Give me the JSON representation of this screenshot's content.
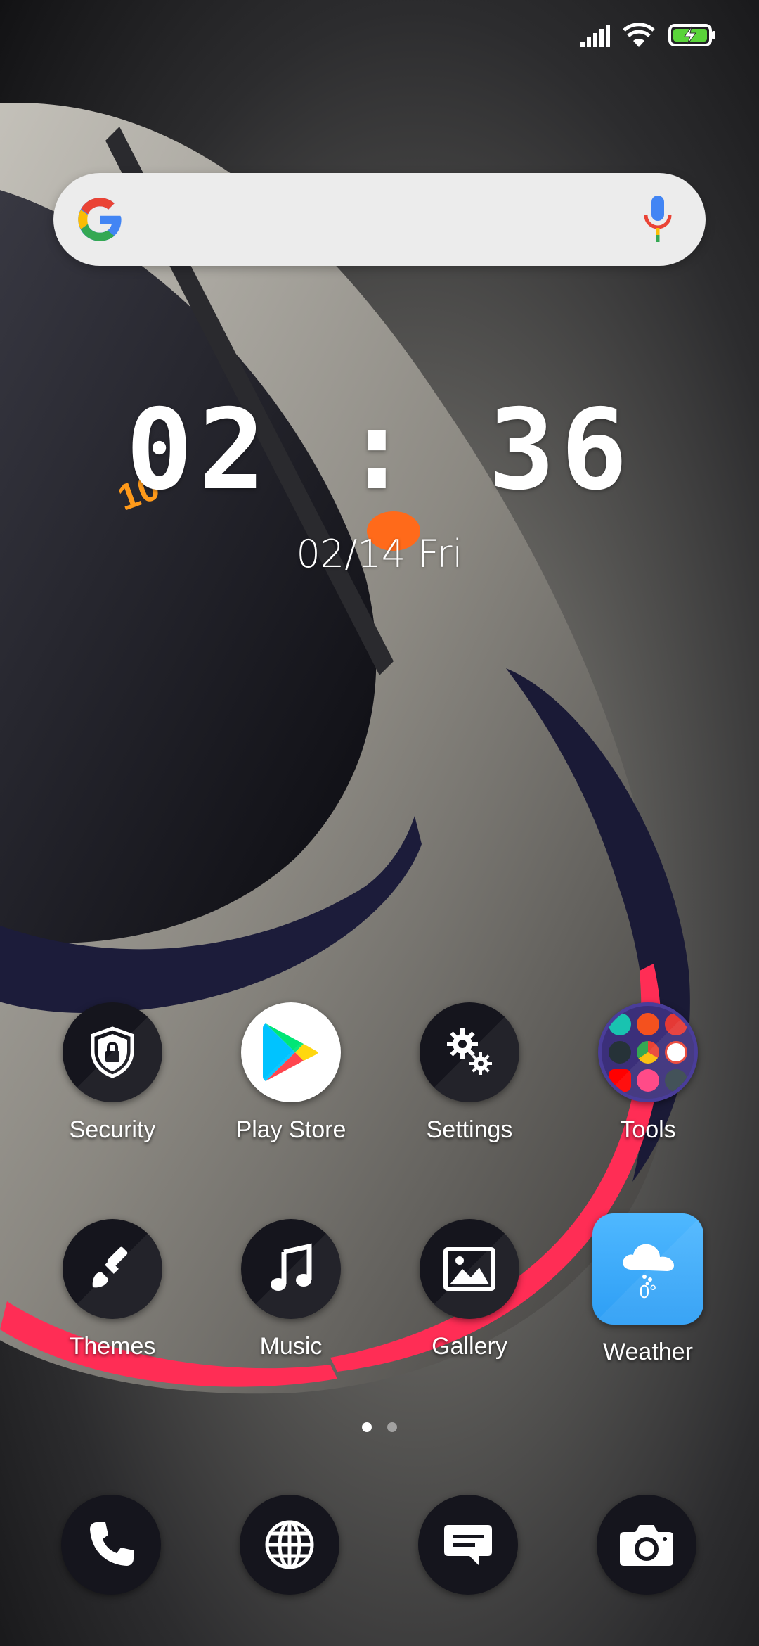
{
  "status_bar": {
    "icons": [
      "signal-icon",
      "wifi-icon",
      "battery-charging-icon"
    ],
    "battery_color": "#5ad43a"
  },
  "search_widget": {
    "logo": "google-logo",
    "mic_icon": "mic-icon"
  },
  "clock": {
    "time": "02 : 36",
    "date": "02/14 Fri"
  },
  "apps": [
    {
      "label": "Security",
      "icon": "shield-lock-icon"
    },
    {
      "label": "Play Store",
      "icon": "play-store-icon"
    },
    {
      "label": "Settings",
      "icon": "gears-icon"
    },
    {
      "label": "Tools",
      "icon": "folder-icon"
    },
    {
      "label": "Themes",
      "icon": "paintbrush-icon"
    },
    {
      "label": "Music",
      "icon": "music-note-icon"
    },
    {
      "label": "Gallery",
      "icon": "picture-icon"
    },
    {
      "label": "Weather",
      "icon": "cloud-icon",
      "temp": "0°"
    }
  ],
  "pager": {
    "pages": 2,
    "current": 1
  },
  "dock": [
    {
      "icon": "phone-icon"
    },
    {
      "icon": "globe-icon"
    },
    {
      "icon": "message-icon"
    },
    {
      "icon": "camera-icon"
    }
  ],
  "colors": {
    "icon_bg": "#15151d",
    "weather_bg": "#3aa8f7",
    "folder_bg": "#3b2f7a",
    "accent_red": "#ff2d55"
  }
}
